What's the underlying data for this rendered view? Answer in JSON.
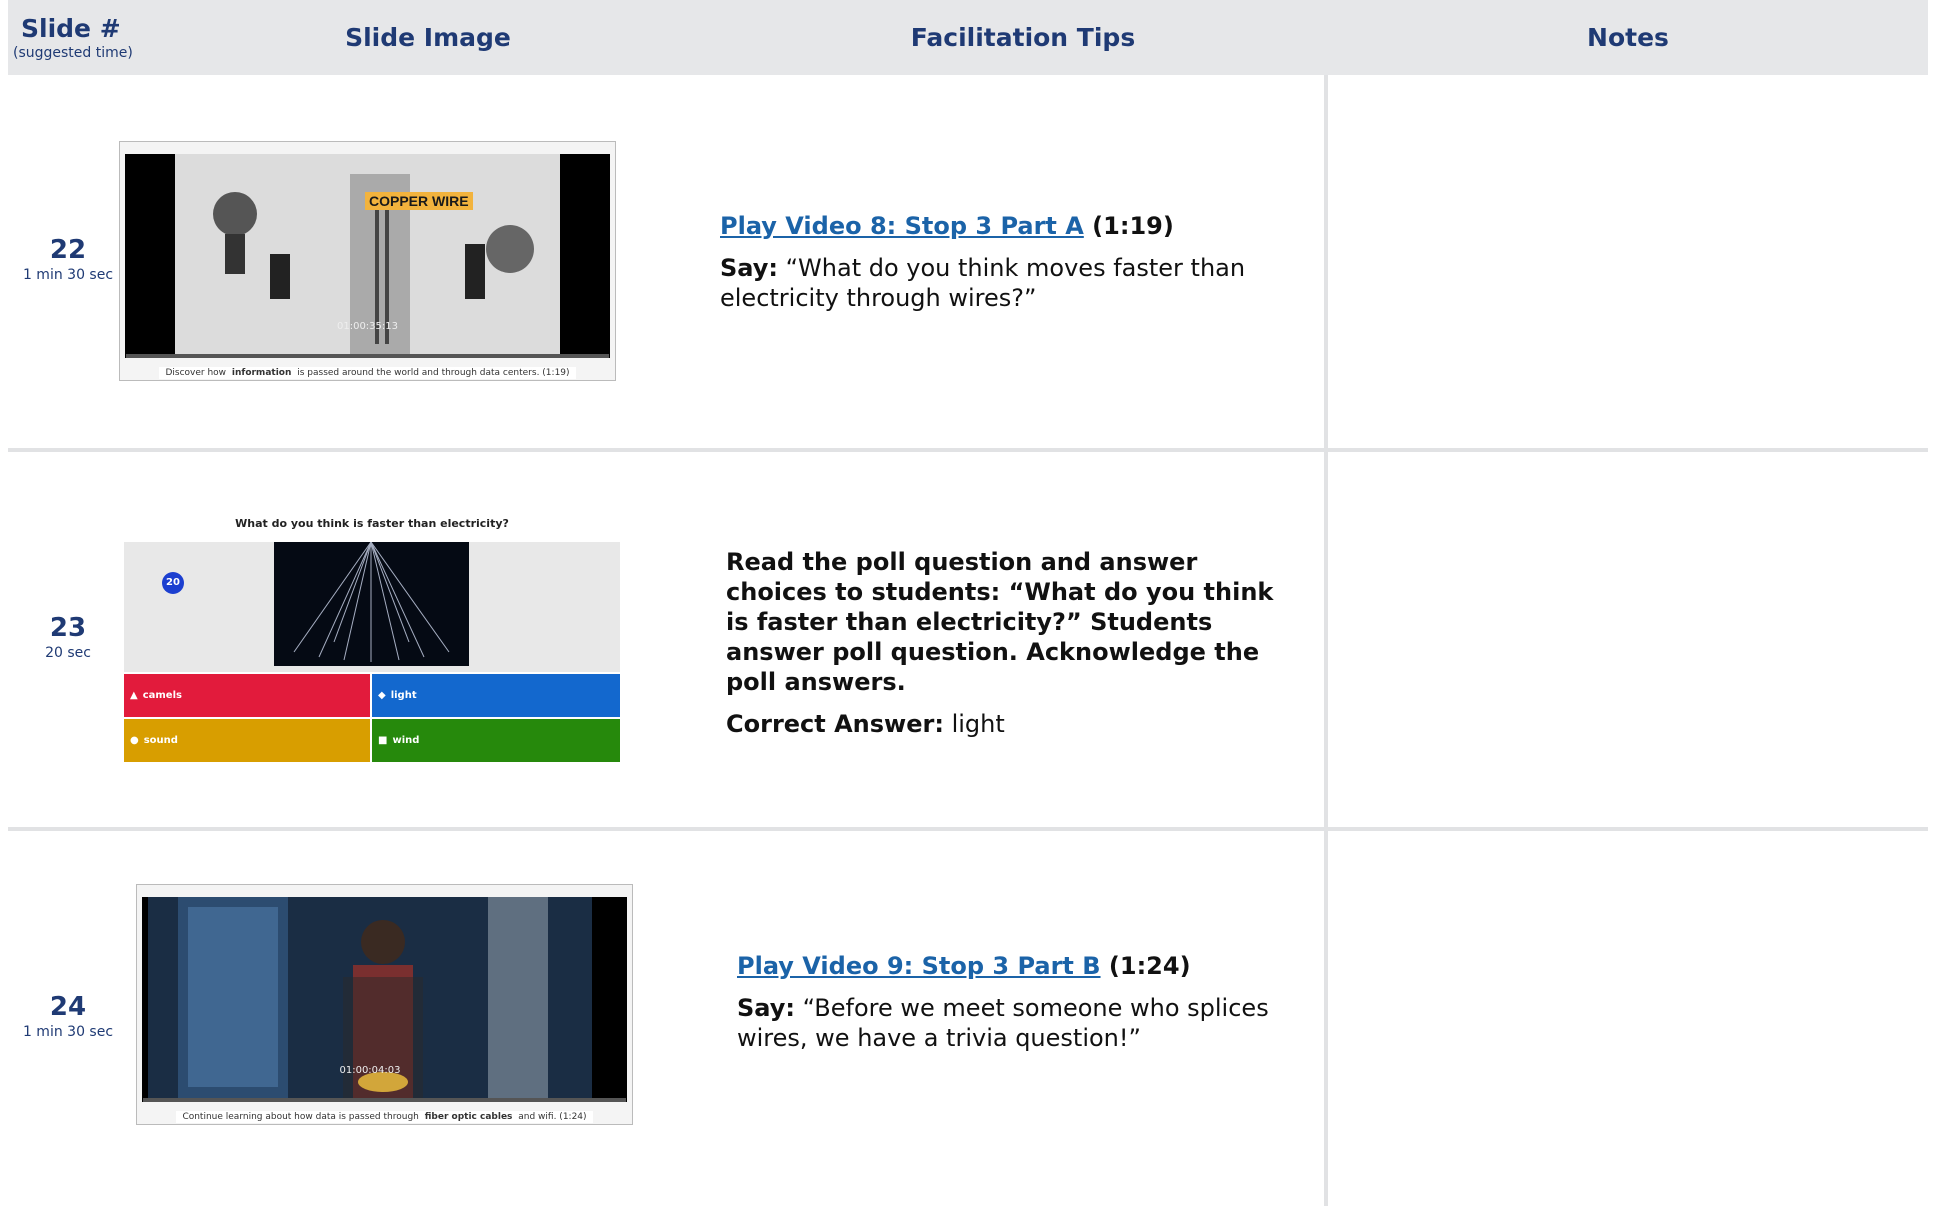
{
  "header": {
    "slide_col": "Slide #",
    "slide_col_sub": "(suggested time)",
    "image_col": "Slide Image",
    "tips_col": "Facilitation Tips",
    "notes_col": "Notes"
  },
  "rows": [
    {
      "number": "22",
      "time": "1 min 30 sec",
      "thumb": {
        "title": "COPPER WIRE",
        "timecode": "01:00:35:13",
        "caption_pre": "Discover how ",
        "caption_bold": "information",
        "caption_post": " is passed around the world and through data centers. (1:19)"
      },
      "link": "Play Video 8: Stop 3 Part A",
      "duration": " (1:19)",
      "say_label": "Say:",
      "say_text": " “What do you think moves faster than electricity through wires?”"
    },
    {
      "number": "23",
      "time": "20 sec",
      "thumb": {
        "question": "What do you think is faster than electricity?",
        "timer": "20",
        "answers": [
          "camels",
          "light",
          "sound",
          "wind"
        ]
      },
      "instruction": "Read the poll question and answer choices to students: “What do you think is faster than electricity?” Students answer poll question. Acknowledge the poll answers.",
      "answer_label": "Correct Answer:",
      "answer_text": " light"
    },
    {
      "number": "24",
      "time": "1 min 30 sec",
      "thumb": {
        "timecode": "01:00:04:03",
        "caption_pre": "Continue learning about how data is passed through ",
        "caption_bold": "fiber optic cables",
        "caption_post": " and wifi. (1:24)"
      },
      "link": "Play Video 9: Stop 3 Part B",
      "duration": " (1:24)",
      "say_label": "Say:",
      "say_text": " “Before we meet someone who splices wires, we have a trivia question!”"
    }
  ]
}
